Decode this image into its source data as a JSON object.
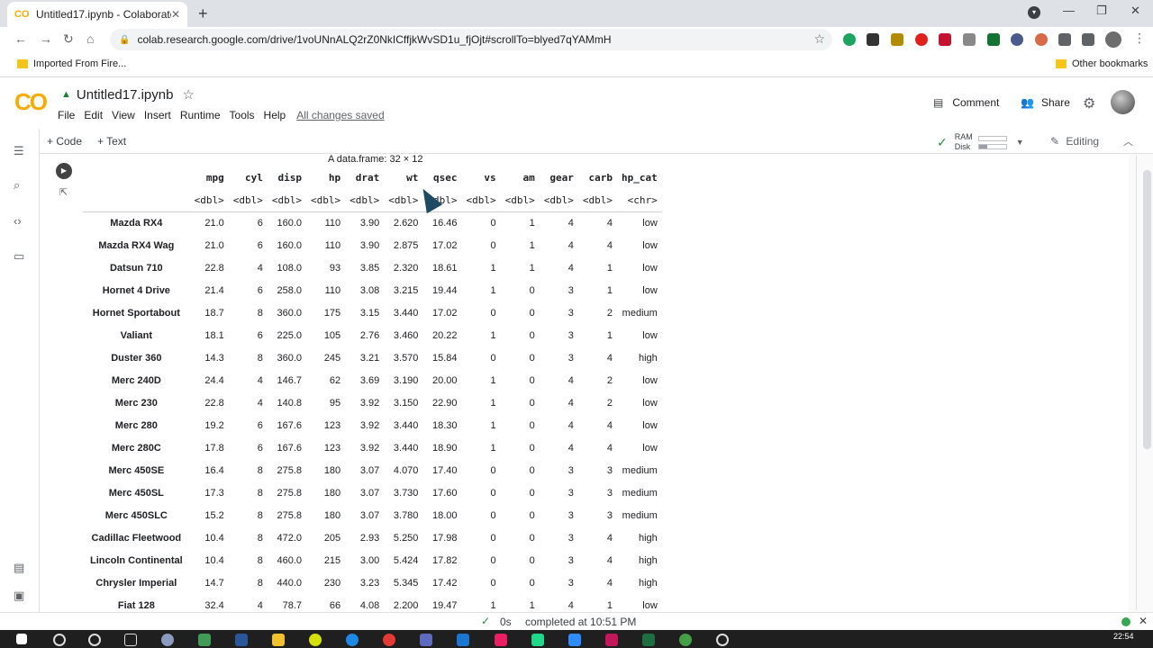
{
  "browser": {
    "tab_title": "Untitled17.ipynb - Colaboratory",
    "url": "colab.research.google.com/drive/1voUNnALQ2rZ0NkICffjkWvSD1u_fjOjt#scrollTo=blyed7qYAMmH",
    "bookmark_left": "Imported From Fire...",
    "bookmark_right": "Other bookmarks"
  },
  "colab": {
    "logo": "CO",
    "notebook_title": "Untitled17.ipynb",
    "menu": [
      "File",
      "Edit",
      "View",
      "Insert",
      "Runtime",
      "Tools",
      "Help"
    ],
    "save_status": "All changes saved",
    "comment_label": "Comment",
    "share_label": "Share",
    "add_code": "+ Code",
    "add_text": "+ Text",
    "ram_label": "RAM",
    "disk_label": "Disk",
    "ram_usage": 0.0,
    "disk_usage": 0.3,
    "mode_label": "Editing"
  },
  "output": {
    "caption": "A data.frame: 32 × 12",
    "columns": [
      "",
      "mpg",
      "cyl",
      "disp",
      "hp",
      "drat",
      "wt",
      "qsec",
      "vs",
      "am",
      "gear",
      "carb",
      "hp_cat"
    ],
    "types": [
      "",
      "<dbl>",
      "<dbl>",
      "<dbl>",
      "<dbl>",
      "<dbl>",
      "<dbl>",
      "<dbl>",
      "<dbl>",
      "<dbl>",
      "<dbl>",
      "<dbl>",
      "<chr>"
    ],
    "rows": [
      [
        "Mazda RX4",
        "21.0",
        "6",
        "160.0",
        "110",
        "3.90",
        "2.620",
        "16.46",
        "0",
        "1",
        "4",
        "4",
        "low"
      ],
      [
        "Mazda RX4 Wag",
        "21.0",
        "6",
        "160.0",
        "110",
        "3.90",
        "2.875",
        "17.02",
        "0",
        "1",
        "4",
        "4",
        "low"
      ],
      [
        "Datsun 710",
        "22.8",
        "4",
        "108.0",
        "93",
        "3.85",
        "2.320",
        "18.61",
        "1",
        "1",
        "4",
        "1",
        "low"
      ],
      [
        "Hornet 4 Drive",
        "21.4",
        "6",
        "258.0",
        "110",
        "3.08",
        "3.215",
        "19.44",
        "1",
        "0",
        "3",
        "1",
        "low"
      ],
      [
        "Hornet Sportabout",
        "18.7",
        "8",
        "360.0",
        "175",
        "3.15",
        "3.440",
        "17.02",
        "0",
        "0",
        "3",
        "2",
        "medium"
      ],
      [
        "Valiant",
        "18.1",
        "6",
        "225.0",
        "105",
        "2.76",
        "3.460",
        "20.22",
        "1",
        "0",
        "3",
        "1",
        "low"
      ],
      [
        "Duster 360",
        "14.3",
        "8",
        "360.0",
        "245",
        "3.21",
        "3.570",
        "15.84",
        "0",
        "0",
        "3",
        "4",
        "high"
      ],
      [
        "Merc 240D",
        "24.4",
        "4",
        "146.7",
        "62",
        "3.69",
        "3.190",
        "20.00",
        "1",
        "0",
        "4",
        "2",
        "low"
      ],
      [
        "Merc 230",
        "22.8",
        "4",
        "140.8",
        "95",
        "3.92",
        "3.150",
        "22.90",
        "1",
        "0",
        "4",
        "2",
        "low"
      ],
      [
        "Merc 280",
        "19.2",
        "6",
        "167.6",
        "123",
        "3.92",
        "3.440",
        "18.30",
        "1",
        "0",
        "4",
        "4",
        "low"
      ],
      [
        "Merc 280C",
        "17.8",
        "6",
        "167.6",
        "123",
        "3.92",
        "3.440",
        "18.90",
        "1",
        "0",
        "4",
        "4",
        "low"
      ],
      [
        "Merc 450SE",
        "16.4",
        "8",
        "275.8",
        "180",
        "3.07",
        "4.070",
        "17.40",
        "0",
        "0",
        "3",
        "3",
        "medium"
      ],
      [
        "Merc 450SL",
        "17.3",
        "8",
        "275.8",
        "180",
        "3.07",
        "3.730",
        "17.60",
        "0",
        "0",
        "3",
        "3",
        "medium"
      ],
      [
        "Merc 450SLC",
        "15.2",
        "8",
        "275.8",
        "180",
        "3.07",
        "3.780",
        "18.00",
        "0",
        "0",
        "3",
        "3",
        "medium"
      ],
      [
        "Cadillac Fleetwood",
        "10.4",
        "8",
        "472.0",
        "205",
        "2.93",
        "5.250",
        "17.98",
        "0",
        "0",
        "3",
        "4",
        "high"
      ],
      [
        "Lincoln Continental",
        "10.4",
        "8",
        "460.0",
        "215",
        "3.00",
        "5.424",
        "17.82",
        "0",
        "0",
        "3",
        "4",
        "high"
      ],
      [
        "Chrysler Imperial",
        "14.7",
        "8",
        "440.0",
        "230",
        "3.23",
        "5.345",
        "17.42",
        "0",
        "0",
        "3",
        "4",
        "high"
      ],
      [
        "Fiat 128",
        "32.4",
        "4",
        "78.7",
        "66",
        "4.08",
        "2.200",
        "19.47",
        "1",
        "1",
        "4",
        "1",
        "low"
      ]
    ]
  },
  "status": {
    "duration": "0s",
    "message": "completed at 10:51 PM"
  },
  "taskbar": {
    "time": "22:54"
  }
}
